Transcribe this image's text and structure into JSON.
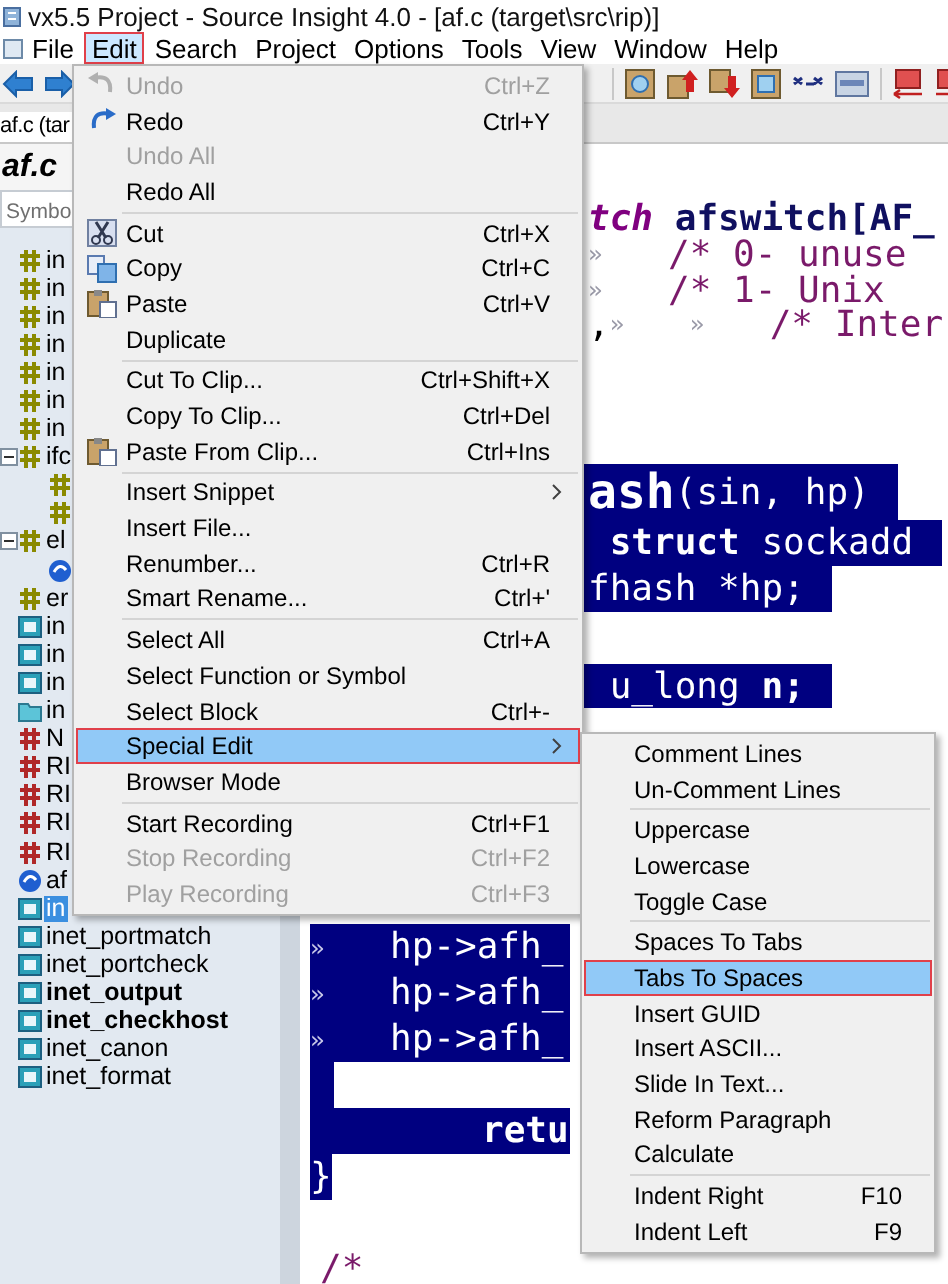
{
  "window": {
    "title": "vx5.5 Project - Source Insight 4.0 - [af.c (target\\src\\rip)]"
  },
  "menu_bar": [
    {
      "label": "File",
      "selected": false
    },
    {
      "label": "Edit",
      "selected": true
    },
    {
      "label": "Search",
      "selected": false
    },
    {
      "label": "Project",
      "selected": false
    },
    {
      "label": "Options",
      "selected": false
    },
    {
      "label": "Tools",
      "selected": false
    },
    {
      "label": "View",
      "selected": false
    },
    {
      "label": "Window",
      "selected": false
    },
    {
      "label": "Help",
      "selected": false
    }
  ],
  "tabs": [
    {
      "label": "af.c (tar"
    }
  ],
  "symbol_panel": {
    "file": "af.c",
    "search": {
      "placeholder": "Symbo"
    },
    "items": [
      {
        "kind": "constant",
        "label": "in",
        "selected": false,
        "bold": false
      },
      {
        "kind": "constant",
        "label": "in",
        "selected": false,
        "bold": false
      },
      {
        "kind": "constant",
        "label": "in",
        "selected": false,
        "bold": false
      },
      {
        "kind": "constant",
        "label": "in",
        "selected": false,
        "bold": false
      },
      {
        "kind": "constant",
        "label": "in",
        "selected": false,
        "bold": false
      },
      {
        "kind": "constant",
        "label": "in",
        "selected": false,
        "bold": false
      },
      {
        "kind": "constant",
        "label": "in",
        "selected": false,
        "bold": false
      },
      {
        "kind": "constant",
        "label": "ifc",
        "selected": false,
        "bold": false,
        "expanded": true,
        "children": [
          {
            "kind": "constant"
          },
          {
            "kind": "constant"
          }
        ]
      },
      {
        "kind": "constant",
        "label": "el",
        "selected": false,
        "bold": false,
        "expanded": true,
        "children": [
          {
            "kind": "variable"
          }
        ]
      },
      {
        "kind": "constant",
        "label": "er",
        "selected": false,
        "bold": false
      },
      {
        "kind": "function",
        "label": "in",
        "selected": false,
        "bold": false
      },
      {
        "kind": "function",
        "label": "in",
        "selected": false,
        "bold": false
      },
      {
        "kind": "function",
        "label": "in",
        "selected": false,
        "bold": false
      },
      {
        "kind": "type",
        "label": "in",
        "selected": false,
        "bold": false
      },
      {
        "kind": "macro",
        "label": "N",
        "selected": false,
        "bold": false
      },
      {
        "kind": "macro",
        "label": "RI",
        "selected": false,
        "bold": false
      },
      {
        "kind": "macro",
        "label": "RI",
        "selected": false,
        "bold": false
      },
      {
        "kind": "macro",
        "label": "RI",
        "selected": false,
        "bold": false
      },
      {
        "kind": "macro",
        "label": "RI",
        "selected": false,
        "bold": false
      },
      {
        "kind": "variable",
        "label": "af",
        "selected": false,
        "bold": false
      },
      {
        "kind": "function",
        "label": "in",
        "selected": true,
        "bold": false
      },
      {
        "kind": "function",
        "label": "inet_portmatch",
        "selected": false,
        "bold": false
      },
      {
        "kind": "function",
        "label": "inet_portcheck",
        "selected": false,
        "bold": false
      },
      {
        "kind": "function",
        "label": "inet_output",
        "selected": false,
        "bold": true
      },
      {
        "kind": "function",
        "label": "inet_checkhost",
        "selected": false,
        "bold": true
      },
      {
        "kind": "function",
        "label": "inet_canon",
        "selected": false,
        "bold": false
      },
      {
        "kind": "function",
        "label": "inet_format",
        "selected": false,
        "bold": false
      }
    ]
  },
  "editor": {
    "upper_lines": [
      {
        "highlighted": false,
        "segments": [
          {
            "kind": "keyword",
            "text": "tch"
          },
          {
            "kind": "identifier",
            "text": " afswitch[AF_"
          }
        ]
      },
      {
        "highlighted": false,
        "segments": [
          {
            "kind": "tab",
            "text": "»"
          },
          {
            "kind": "comment",
            "text": "/* 0- unuse"
          }
        ]
      },
      {
        "highlighted": false,
        "segments": [
          {
            "kind": "tab",
            "text": "»"
          },
          {
            "kind": "comment",
            "text": "/* 1- Unix"
          }
        ]
      },
      {
        "highlighted": false,
        "segments": [
          {
            "kind": "plain",
            "text": ","
          },
          {
            "kind": "tab",
            "text": "»"
          },
          {
            "kind": "tab",
            "text": "»"
          },
          {
            "kind": "comment",
            "text": "/* Inter"
          }
        ]
      },
      {
        "highlighted": true,
        "segments": [
          {
            "kind": "function",
            "text": "ash"
          },
          {
            "kind": "plain",
            "text": "(sin, hp)"
          }
        ]
      },
      {
        "highlighted": true,
        "segments": [
          {
            "kind": "keyword",
            "text": " struct"
          },
          {
            "kind": "plain",
            "text": " sockadd"
          }
        ]
      },
      {
        "highlighted": true,
        "segments": [
          {
            "kind": "plain",
            "text": "fhash *hp;"
          }
        ]
      },
      {
        "highlighted": true,
        "segments": [
          {
            "kind": "plain",
            "text": " u_long"
          },
          {
            "kind": "identifier",
            "text": " n;"
          }
        ]
      }
    ],
    "lower_lines": [
      {
        "highlighted": true,
        "segments": [
          {
            "kind": "tab",
            "text": "»"
          },
          {
            "kind": "plain",
            "text": "hp->afh_"
          }
        ]
      },
      {
        "highlighted": true,
        "segments": [
          {
            "kind": "tab",
            "text": "»"
          },
          {
            "kind": "plain",
            "text": "hp->afh_"
          }
        ]
      },
      {
        "highlighted": true,
        "segments": [
          {
            "kind": "tab",
            "text": "»"
          },
          {
            "kind": "plain",
            "text": "hp->afh_"
          }
        ]
      },
      {
        "highlighted": true
      },
      {
        "highlighted": true,
        "segments": [
          {
            "kind": "keyword",
            "text": "retu"
          }
        ]
      },
      {
        "highlighted": true,
        "segments": [
          {
            "kind": "plain",
            "text": "}"
          }
        ]
      },
      {
        "highlighted": false,
        "segments": [
          {
            "kind": "comment",
            "text": "/*"
          }
        ]
      }
    ]
  },
  "edit_menu": {
    "items": [
      {
        "kind": "item",
        "label": "Undo",
        "shortcut": "Ctrl+Z",
        "disabled": true,
        "selected": false
      },
      {
        "kind": "item",
        "label": "Redo",
        "shortcut": "Ctrl+Y",
        "disabled": false,
        "selected": false
      },
      {
        "kind": "item",
        "label": "Undo All",
        "disabled": true,
        "selected": false
      },
      {
        "kind": "item",
        "label": "Redo All",
        "disabled": false,
        "selected": false
      },
      {
        "kind": "separator"
      },
      {
        "kind": "item",
        "label": "Cut",
        "shortcut": "Ctrl+X",
        "disabled": false,
        "selected": false
      },
      {
        "kind": "item",
        "label": "Copy",
        "shortcut": "Ctrl+C",
        "disabled": false,
        "selected": false
      },
      {
        "kind": "item",
        "label": "Paste",
        "shortcut": "Ctrl+V",
        "disabled": false,
        "selected": false
      },
      {
        "kind": "item",
        "label": "Duplicate",
        "disabled": false,
        "selected": false
      },
      {
        "kind": "separator"
      },
      {
        "kind": "item",
        "label": "Cut To Clip...",
        "shortcut": "Ctrl+Shift+X",
        "disabled": false,
        "selected": false
      },
      {
        "kind": "item",
        "label": "Copy To Clip...",
        "shortcut": "Ctrl+Del",
        "disabled": false,
        "selected": false
      },
      {
        "kind": "item",
        "label": "Paste From Clip...",
        "shortcut": "Ctrl+Ins",
        "disabled": false,
        "selected": false
      },
      {
        "kind": "separator"
      },
      {
        "kind": "item",
        "label": "Insert Snippet",
        "submenu": true,
        "disabled": false,
        "selected": false
      },
      {
        "kind": "item",
        "label": "Insert File...",
        "disabled": false,
        "selected": false
      },
      {
        "kind": "item",
        "label": "Renumber...",
        "shortcut": "Ctrl+R",
        "disabled": false,
        "selected": false
      },
      {
        "kind": "item",
        "label": "Smart Rename...",
        "shortcut": "Ctrl+'",
        "disabled": false,
        "selected": false
      },
      {
        "kind": "separator"
      },
      {
        "kind": "item",
        "label": "Select All",
        "shortcut": "Ctrl+A",
        "disabled": false,
        "selected": false
      },
      {
        "kind": "item",
        "label": "Select Function or Symbol",
        "disabled": false,
        "selected": false
      },
      {
        "kind": "item",
        "label": "Select Block",
        "shortcut": "Ctrl+-",
        "disabled": false,
        "selected": false
      },
      {
        "kind": "item",
        "label": "Special Edit",
        "submenu": true,
        "disabled": false,
        "selected": true
      },
      {
        "kind": "item",
        "label": "Browser Mode",
        "disabled": false,
        "selected": false
      },
      {
        "kind": "separator"
      },
      {
        "kind": "item",
        "label": "Start Recording",
        "shortcut": "Ctrl+F1",
        "disabled": false,
        "selected": false
      },
      {
        "kind": "item",
        "label": "Stop Recording",
        "shortcut": "Ctrl+F2",
        "disabled": true,
        "selected": false
      },
      {
        "kind": "item",
        "label": "Play Recording",
        "shortcut": "Ctrl+F3",
        "disabled": true,
        "selected": false
      }
    ]
  },
  "special_edit_menu": {
    "items": [
      {
        "kind": "item",
        "label": "Comment Lines",
        "disabled": false,
        "selected": false
      },
      {
        "kind": "item",
        "label": "Un-Comment Lines",
        "disabled": false,
        "selected": false
      },
      {
        "kind": "separator"
      },
      {
        "kind": "item",
        "label": "Uppercase",
        "disabled": false,
        "selected": false
      },
      {
        "kind": "item",
        "label": "Lowercase",
        "disabled": false,
        "selected": false
      },
      {
        "kind": "item",
        "label": "Toggle Case",
        "disabled": false,
        "selected": false
      },
      {
        "kind": "separator"
      },
      {
        "kind": "item",
        "label": "Spaces To Tabs",
        "disabled": false,
        "selected": false
      },
      {
        "kind": "item",
        "label": "Tabs To Spaces",
        "disabled": false,
        "selected": true
      },
      {
        "kind": "item",
        "label": "Insert GUID",
        "disabled": false,
        "selected": false
      },
      {
        "kind": "item",
        "label": "Insert ASCII...",
        "disabled": false,
        "selected": false
      },
      {
        "kind": "item",
        "label": "Slide In Text...",
        "disabled": false,
        "selected": false
      },
      {
        "kind": "item",
        "label": "Reform Paragraph",
        "disabled": false,
        "selected": false
      },
      {
        "kind": "item",
        "label": "Calculate",
        "disabled": false,
        "selected": false
      },
      {
        "kind": "separator"
      },
      {
        "kind": "item",
        "label": "Indent Right",
        "shortcut": "F10",
        "disabled": false,
        "selected": false
      },
      {
        "kind": "item",
        "label": "Indent Left",
        "shortcut": "F9",
        "disabled": false,
        "selected": false
      }
    ]
  }
}
